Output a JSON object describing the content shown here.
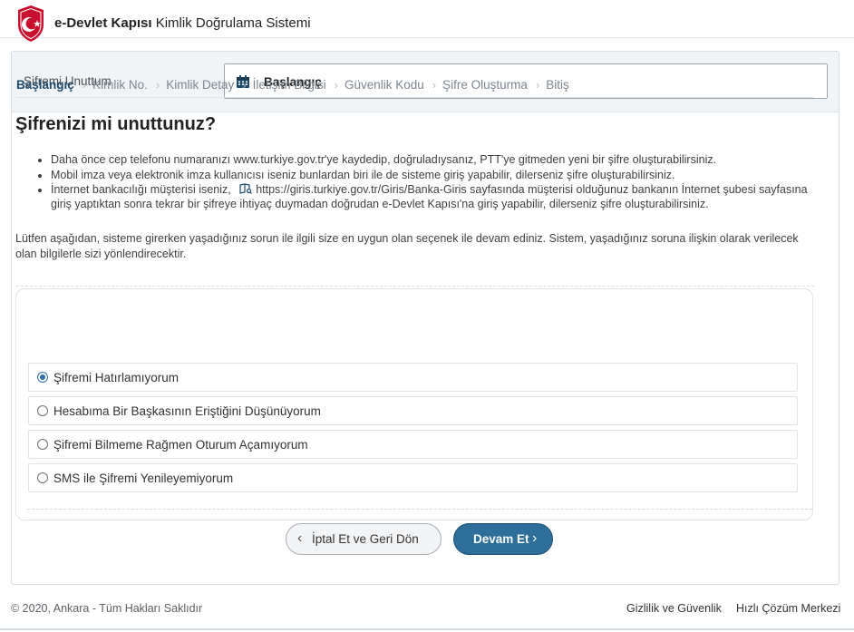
{
  "header": {
    "brand_bold": "e-Devlet Kapısı",
    "brand_rest": "Kimlik Doğrulama Sistemi",
    "logo_icon": "crescent-shield-icon",
    "logo_color": "#c8102e"
  },
  "page_header": {
    "title": "Şifremi Unuttum",
    "selected_step": "Başlangıç",
    "select_icon": "calendar-icon"
  },
  "steps": [
    "Başlangıç",
    "Kimlik No.",
    "Kimlik Detay",
    "İletişim Bilgisi",
    "Güvenlik Kodu",
    "Şifre Oluşturma",
    "Bitiş"
  ],
  "heading": "Şifrenizi mi unuttunuz?",
  "bullets": {
    "b1": "Daha önce cep telefonu numaranızı www.turkiye.gov.tr'ye kaydedip, doğruladıysanız, PTT'ye gitmeden yeni bir şifre oluşturabilirsiniz.",
    "b2": "Mobil imza veya elektronik imza kullanıcısı iseniz bunlardan biri ile de sisteme giriş yapabilir, dilerseniz şifre oluşturabilirsiniz.",
    "b3_pre": "İnternet bankacılığı müşterisi iseniz,",
    "b3_link": "https://giris.turkiye.gov.tr/Giris/Banka-Giris",
    "b3_post": "sayfasında müşterisi olduğunuz bankanın İnternet şubesi sayfasına giriş yaptıktan sonra tekrar bir şifreye ihtiyaç duymadan doğrudan e-Devlet Kapısı'na giriş yapabilir, dilerseniz şifre oluşturabilirsiniz.",
    "link_icon": "external-book-icon"
  },
  "intro": "Lütfen aşağıdan, sisteme girerken yaşadığınız sorun ile ilgili size en uygun olan seçenek ile devam ediniz. Sistem, yaşadığınız soruna ilişkin olarak verilecek olan bilgilerle sizi yönlendirecektir.",
  "options": [
    {
      "label": "Şifremi Hatırlamıyorum",
      "checked": true
    },
    {
      "label": "Hesabıma Bir Başkasının Eriştiğini Düşünüyorum",
      "checked": false
    },
    {
      "label": "Şifremi Bilmeme Rağmen Oturum Açamıyorum",
      "checked": false
    },
    {
      "label": "SMS ile Şifremi Yenileyemiyorum",
      "checked": false
    }
  ],
  "buttons": {
    "cancel": "İptal Et ve Geri Dön",
    "next": "Devam Et",
    "cancel_icon": "chevron-left-icon",
    "next_icon": "chevron-right-icon",
    "primary_color": "#2d6e9a"
  },
  "footer": {
    "copyright": "© 2020, Ankara - Tüm Hakları Saklıdır",
    "privacy": "Gizlilik ve Güvenlik",
    "help": "Hızlı Çözüm Merkezi"
  }
}
